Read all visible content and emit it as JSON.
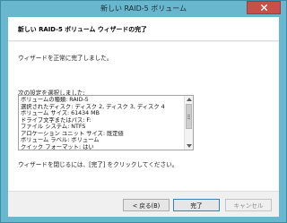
{
  "window": {
    "title": "新しい RAID-5 ボリューム",
    "close_icon": "close-icon"
  },
  "header": {
    "title": "新しい RAID-5 ボリューム ウィザードの完了"
  },
  "body": {
    "intro": "ウィザードを正常に完了しました。",
    "settings_label": "次の設定を選択しました:",
    "settings_lines": [
      "ボリュームの種類: RAID-5",
      "選択されたディスク: ディスク 2, ディスク 3, ディスク 4",
      "ボリューム サイズ: 61434 MB",
      "ドライブ文字またはパス: F:",
      "ファイル システム: NTFS",
      "アロケーション ユニット サイズ: 既定値",
      "ボリューム ラベル: ボリューム",
      "クイック フォーマット: はい"
    ],
    "finish_message": "ウィザードを閉じるには、[完了] をクリックしてください。"
  },
  "footer": {
    "back_label": "< 戻る(B)",
    "finish_label": "完了",
    "cancel_label": "キャンセル"
  },
  "colors": {
    "titlebar": "#69b7cf",
    "close_button": "#c7504b"
  }
}
